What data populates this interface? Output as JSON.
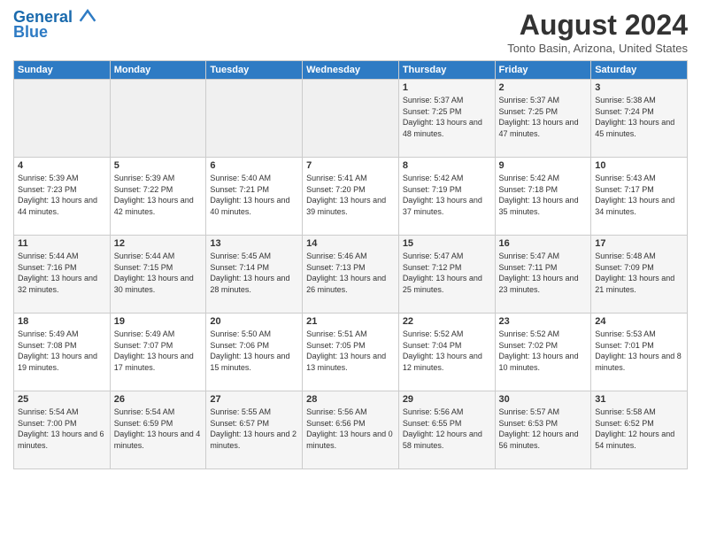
{
  "header": {
    "logo_line1": "General",
    "logo_line2": "Blue",
    "month_year": "August 2024",
    "location": "Tonto Basin, Arizona, United States"
  },
  "days_of_week": [
    "Sunday",
    "Monday",
    "Tuesday",
    "Wednesday",
    "Thursday",
    "Friday",
    "Saturday"
  ],
  "weeks": [
    [
      {
        "date": "",
        "sunrise": "",
        "sunset": "",
        "daylight": ""
      },
      {
        "date": "",
        "sunrise": "",
        "sunset": "",
        "daylight": ""
      },
      {
        "date": "",
        "sunrise": "",
        "sunset": "",
        "daylight": ""
      },
      {
        "date": "",
        "sunrise": "",
        "sunset": "",
        "daylight": ""
      },
      {
        "date": "1",
        "sunrise": "Sunrise: 5:37 AM",
        "sunset": "Sunset: 7:25 PM",
        "daylight": "Daylight: 13 hours and 48 minutes."
      },
      {
        "date": "2",
        "sunrise": "Sunrise: 5:37 AM",
        "sunset": "Sunset: 7:25 PM",
        "daylight": "Daylight: 13 hours and 47 minutes."
      },
      {
        "date": "3",
        "sunrise": "Sunrise: 5:38 AM",
        "sunset": "Sunset: 7:24 PM",
        "daylight": "Daylight: 13 hours and 45 minutes."
      }
    ],
    [
      {
        "date": "4",
        "sunrise": "Sunrise: 5:39 AM",
        "sunset": "Sunset: 7:23 PM",
        "daylight": "Daylight: 13 hours and 44 minutes."
      },
      {
        "date": "5",
        "sunrise": "Sunrise: 5:39 AM",
        "sunset": "Sunset: 7:22 PM",
        "daylight": "Daylight: 13 hours and 42 minutes."
      },
      {
        "date": "6",
        "sunrise": "Sunrise: 5:40 AM",
        "sunset": "Sunset: 7:21 PM",
        "daylight": "Daylight: 13 hours and 40 minutes."
      },
      {
        "date": "7",
        "sunrise": "Sunrise: 5:41 AM",
        "sunset": "Sunset: 7:20 PM",
        "daylight": "Daylight: 13 hours and 39 minutes."
      },
      {
        "date": "8",
        "sunrise": "Sunrise: 5:42 AM",
        "sunset": "Sunset: 7:19 PM",
        "daylight": "Daylight: 13 hours and 37 minutes."
      },
      {
        "date": "9",
        "sunrise": "Sunrise: 5:42 AM",
        "sunset": "Sunset: 7:18 PM",
        "daylight": "Daylight: 13 hours and 35 minutes."
      },
      {
        "date": "10",
        "sunrise": "Sunrise: 5:43 AM",
        "sunset": "Sunset: 7:17 PM",
        "daylight": "Daylight: 13 hours and 34 minutes."
      }
    ],
    [
      {
        "date": "11",
        "sunrise": "Sunrise: 5:44 AM",
        "sunset": "Sunset: 7:16 PM",
        "daylight": "Daylight: 13 hours and 32 minutes."
      },
      {
        "date": "12",
        "sunrise": "Sunrise: 5:44 AM",
        "sunset": "Sunset: 7:15 PM",
        "daylight": "Daylight: 13 hours and 30 minutes."
      },
      {
        "date": "13",
        "sunrise": "Sunrise: 5:45 AM",
        "sunset": "Sunset: 7:14 PM",
        "daylight": "Daylight: 13 hours and 28 minutes."
      },
      {
        "date": "14",
        "sunrise": "Sunrise: 5:46 AM",
        "sunset": "Sunset: 7:13 PM",
        "daylight": "Daylight: 13 hours and 26 minutes."
      },
      {
        "date": "15",
        "sunrise": "Sunrise: 5:47 AM",
        "sunset": "Sunset: 7:12 PM",
        "daylight": "Daylight: 13 hours and 25 minutes."
      },
      {
        "date": "16",
        "sunrise": "Sunrise: 5:47 AM",
        "sunset": "Sunset: 7:11 PM",
        "daylight": "Daylight: 13 hours and 23 minutes."
      },
      {
        "date": "17",
        "sunrise": "Sunrise: 5:48 AM",
        "sunset": "Sunset: 7:09 PM",
        "daylight": "Daylight: 13 hours and 21 minutes."
      }
    ],
    [
      {
        "date": "18",
        "sunrise": "Sunrise: 5:49 AM",
        "sunset": "Sunset: 7:08 PM",
        "daylight": "Daylight: 13 hours and 19 minutes."
      },
      {
        "date": "19",
        "sunrise": "Sunrise: 5:49 AM",
        "sunset": "Sunset: 7:07 PM",
        "daylight": "Daylight: 13 hours and 17 minutes."
      },
      {
        "date": "20",
        "sunrise": "Sunrise: 5:50 AM",
        "sunset": "Sunset: 7:06 PM",
        "daylight": "Daylight: 13 hours and 15 minutes."
      },
      {
        "date": "21",
        "sunrise": "Sunrise: 5:51 AM",
        "sunset": "Sunset: 7:05 PM",
        "daylight": "Daylight: 13 hours and 13 minutes."
      },
      {
        "date": "22",
        "sunrise": "Sunrise: 5:52 AM",
        "sunset": "Sunset: 7:04 PM",
        "daylight": "Daylight: 13 hours and 12 minutes."
      },
      {
        "date": "23",
        "sunrise": "Sunrise: 5:52 AM",
        "sunset": "Sunset: 7:02 PM",
        "daylight": "Daylight: 13 hours and 10 minutes."
      },
      {
        "date": "24",
        "sunrise": "Sunrise: 5:53 AM",
        "sunset": "Sunset: 7:01 PM",
        "daylight": "Daylight: 13 hours and 8 minutes."
      }
    ],
    [
      {
        "date": "25",
        "sunrise": "Sunrise: 5:54 AM",
        "sunset": "Sunset: 7:00 PM",
        "daylight": "Daylight: 13 hours and 6 minutes."
      },
      {
        "date": "26",
        "sunrise": "Sunrise: 5:54 AM",
        "sunset": "Sunset: 6:59 PM",
        "daylight": "Daylight: 13 hours and 4 minutes."
      },
      {
        "date": "27",
        "sunrise": "Sunrise: 5:55 AM",
        "sunset": "Sunset: 6:57 PM",
        "daylight": "Daylight: 13 hours and 2 minutes."
      },
      {
        "date": "28",
        "sunrise": "Sunrise: 5:56 AM",
        "sunset": "Sunset: 6:56 PM",
        "daylight": "Daylight: 13 hours and 0 minutes."
      },
      {
        "date": "29",
        "sunrise": "Sunrise: 5:56 AM",
        "sunset": "Sunset: 6:55 PM",
        "daylight": "Daylight: 12 hours and 58 minutes."
      },
      {
        "date": "30",
        "sunrise": "Sunrise: 5:57 AM",
        "sunset": "Sunset: 6:53 PM",
        "daylight": "Daylight: 12 hours and 56 minutes."
      },
      {
        "date": "31",
        "sunrise": "Sunrise: 5:58 AM",
        "sunset": "Sunset: 6:52 PM",
        "daylight": "Daylight: 12 hours and 54 minutes."
      }
    ]
  ]
}
